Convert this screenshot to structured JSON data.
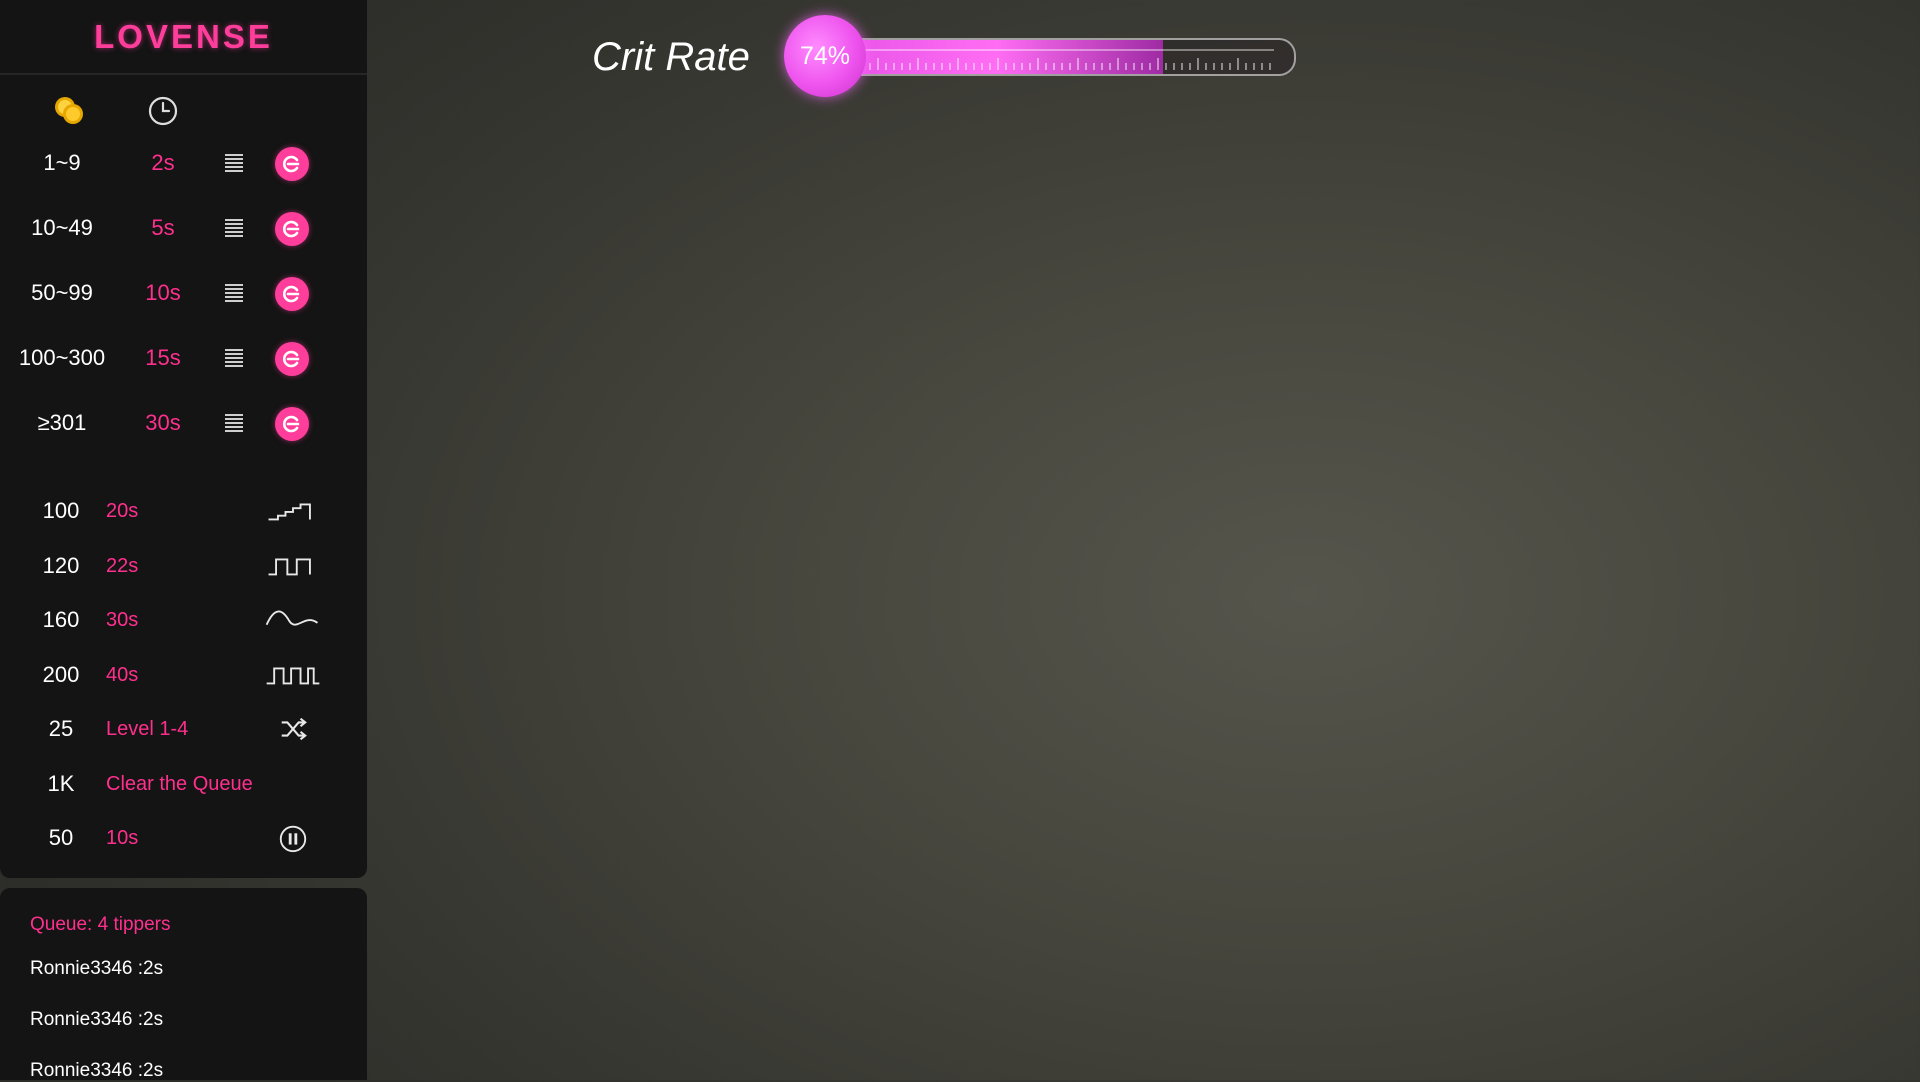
{
  "brand": "LOVENSE",
  "levels": [
    {
      "amount": "1~9",
      "duration": "2s"
    },
    {
      "amount": "10~49",
      "duration": "5s"
    },
    {
      "amount": "50~99",
      "duration": "10s"
    },
    {
      "amount": "100~300",
      "duration": "15s"
    },
    {
      "amount": "≥301",
      "duration": "30s"
    }
  ],
  "specials": [
    {
      "amount": "100",
      "desc": "20s",
      "icon": "stairs-pattern-icon"
    },
    {
      "amount": "120",
      "desc": "22s",
      "icon": "pulse-pattern-icon"
    },
    {
      "amount": "160",
      "desc": "30s",
      "icon": "wave-pattern-icon"
    },
    {
      "amount": "200",
      "desc": "40s",
      "icon": "square-wave-pattern-icon"
    },
    {
      "amount": "25",
      "desc": "Level 1-4",
      "icon": "shuffle-icon"
    },
    {
      "amount": "1K",
      "desc": "Clear the Queue",
      "icon": ""
    },
    {
      "amount": "50",
      "desc": "10s",
      "icon": "pause-icon"
    }
  ],
  "queue": {
    "title": "Queue: 4 tippers",
    "items": [
      "Ronnie3346 :2s",
      "Ronnie3346 :2s",
      "Ronnie3346 :2s"
    ]
  },
  "crit": {
    "label": "Crit Rate",
    "percent_text": "74%",
    "fill_fraction": 0.74
  },
  "colors": {
    "accent": "#ff3d9a",
    "bar": "#ee53ee"
  }
}
